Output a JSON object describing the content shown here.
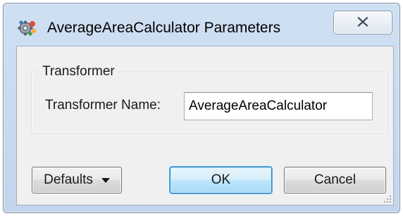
{
  "window": {
    "title": "AverageAreaCalculator Parameters"
  },
  "icons": {
    "app": "transformer-gear-icon",
    "close": "close-icon",
    "dropdown": "caret-down-icon",
    "grip": "size-grip-icon"
  },
  "group": {
    "legend": "Transformer",
    "field_label": "Transformer Name:",
    "field_value": "AverageAreaCalculator"
  },
  "buttons": {
    "defaults_label": "Defaults",
    "ok_label": "OK",
    "cancel_label": "Cancel"
  },
  "colors": {
    "frame": "#c2d5ec",
    "ok_accent": "#3c7fb1",
    "close_glyph": "#3b4a5c"
  }
}
